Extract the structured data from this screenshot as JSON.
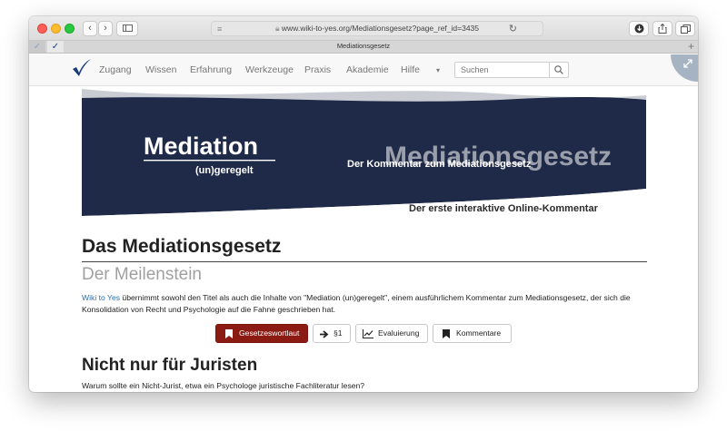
{
  "browser": {
    "url": "www.wiki-to-yes.org/Mediationsgesetz?page_ref_id=3435",
    "tab_title": "Mediationsgesetz"
  },
  "nav": {
    "items": [
      "Zugang",
      "Wissen",
      "Erfahrung",
      "Werkzeuge",
      "Praxis",
      "Akademie",
      "Hilfe"
    ],
    "search_placeholder": "Suchen"
  },
  "banner": {
    "logo_title": "Mediation",
    "logo_sub": "(un)geregelt",
    "big_title": "Mediationsgesetz",
    "subtitle": "Der Kommentar zum Mediationsgesetz",
    "tagline": "Der erste interaktive Online-Kommentar"
  },
  "page": {
    "title": "Das Mediationsgesetz",
    "subtitle": "Der Meilenstein",
    "intro_link": "Wiki to Yes",
    "intro_text": " übernimmt sowohl den Titel als auch die Inhalte von \"Mediation (un)geregelt\", einem ausführlichem Kommentar zum Mediationsgesetz, der sich die Konsolidation von Recht und Psychologie auf die Fahne geschrieben hat.",
    "buttons": [
      "Gesetzeswortlaut",
      "§1",
      "Evaluierung",
      "Kommentare"
    ],
    "section_title": "Nicht nur für Juristen",
    "section_text": "Warum sollte ein Nicht-Jurist, etwa ein Psychologe juristische Fachliteratur lesen?"
  },
  "colors": {
    "banner_navy": "#1f2a48",
    "primary_button": "#8b1a12",
    "link": "#2a6fb0",
    "logo_check": "#1b3a7a"
  }
}
